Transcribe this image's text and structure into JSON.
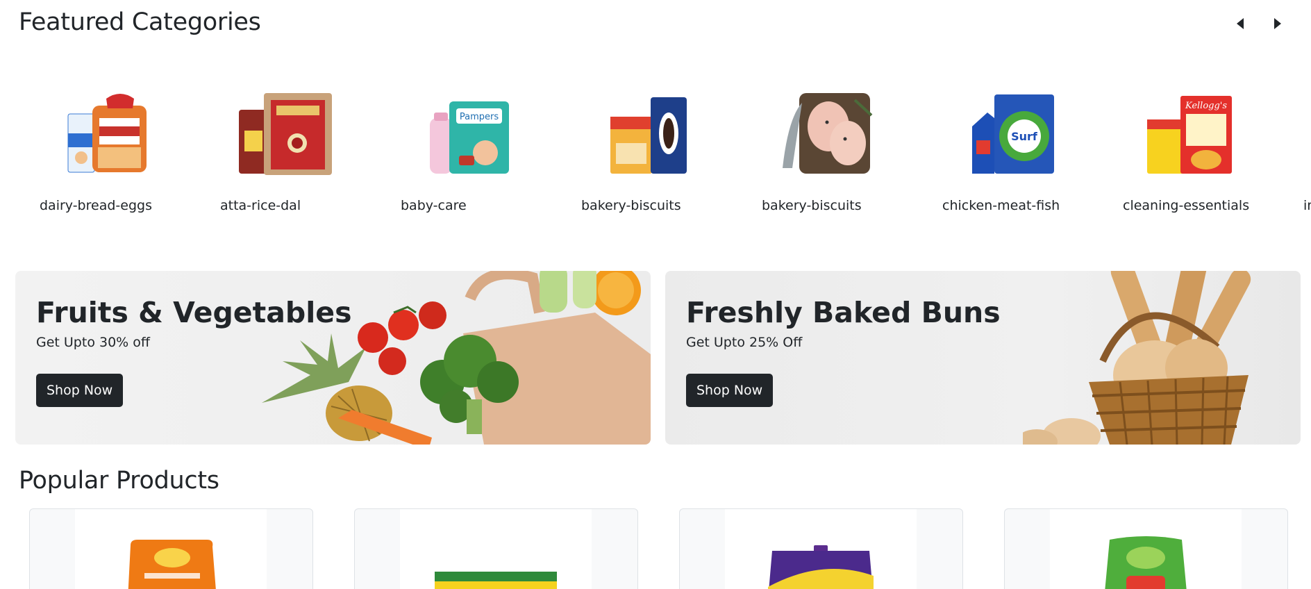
{
  "featured": {
    "title": "Featured Categories",
    "prev_icon": "caret-left-icon",
    "next_icon": "caret-right-icon",
    "categories": [
      {
        "label": "dairy-bread-eggs"
      },
      {
        "label": "atta-rice-dal"
      },
      {
        "label": "baby-care"
      },
      {
        "label": "bakery-biscuits"
      },
      {
        "label": "bakery-biscuits"
      },
      {
        "label": "chicken-meat-fish"
      },
      {
        "label": "cleaning-essentials"
      },
      {
        "label": "in"
      }
    ]
  },
  "banners": [
    {
      "title": "Fruits & Vegetables",
      "subtitle": "Get Upto 30% off",
      "button": "Shop Now"
    },
    {
      "title": "Freshly Baked Buns",
      "subtitle": "Get Upto 25% Off",
      "button": "Shop Now"
    }
  ],
  "popular": {
    "title": "Popular Products"
  },
  "colors": {
    "dark": "#212529",
    "card_border": "#dee2e6",
    "card_bg": "#f8f9fa"
  }
}
